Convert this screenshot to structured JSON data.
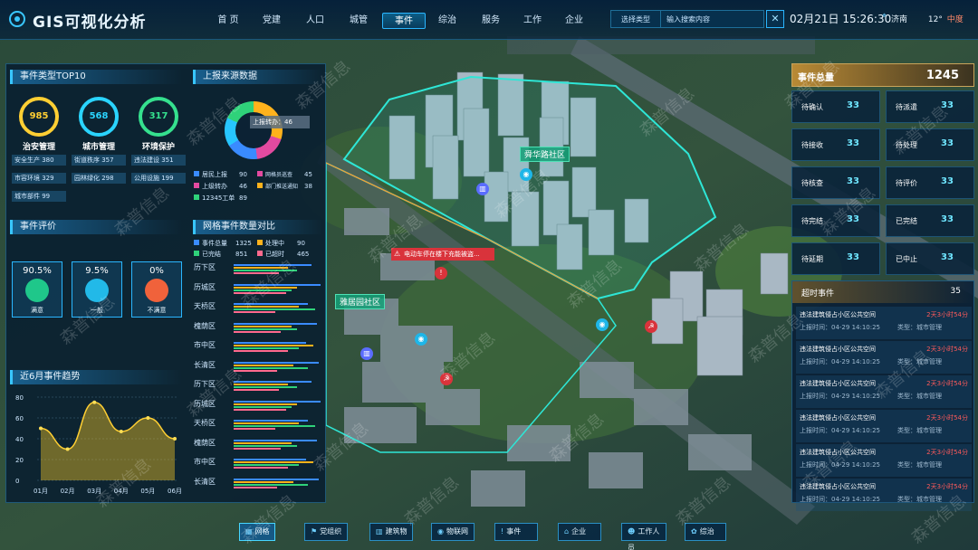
{
  "app": {
    "title": "GIS可视化分析"
  },
  "nav": {
    "items": [
      {
        "label": "首 页"
      },
      {
        "label": "党建"
      },
      {
        "label": "人口"
      },
      {
        "label": "城管"
      },
      {
        "label": "事件"
      },
      {
        "label": "综治"
      },
      {
        "label": "服务"
      },
      {
        "label": "工作"
      },
      {
        "label": "企业"
      }
    ],
    "active": "事件"
  },
  "search": {
    "type_label": "选择类型",
    "placeholder": "输入搜索内容",
    "close": "✕"
  },
  "header": {
    "datetime": "02月21日 15:26:30",
    "city": "济南",
    "temp": "12°",
    "condition": "中度"
  },
  "left": {
    "top10_title": "事件类型TOP10",
    "rings": [
      {
        "value": "985",
        "label": "治安管理",
        "color": "#ffcf33"
      },
      {
        "value": "568",
        "label": "城市管理",
        "color": "#2ad4ff"
      },
      {
        "value": "317",
        "label": "环境保护",
        "color": "#35e08e"
      }
    ],
    "tags": [
      "安全生产 380",
      "街道秩序 357",
      "违法建设 351",
      "市容环境 329",
      "园林绿化 298",
      "公用设施 199",
      "城市部件 99"
    ],
    "source_title": "上报来源数据",
    "tooltip": "上报转办：46",
    "source_legend": [
      {
        "name": "居民上报",
        "value": "90",
        "color": "#3a8bff"
      },
      {
        "name": "网格员巡查",
        "value": "45",
        "color": "#e24aa0"
      },
      {
        "name": "上级转办",
        "value": "46",
        "color": "#e24aa0"
      },
      {
        "name": "部门推送通知",
        "value": "38",
        "color": "#ffb21c"
      },
      {
        "name": "12345工单",
        "value": "89",
        "color": "#2fd27a"
      }
    ],
    "eval_title": "事件评价",
    "evals": [
      {
        "pct": "90.5%",
        "label": "满意",
        "color": "#1fc78a"
      },
      {
        "pct": "9.5%",
        "label": "一般",
        "color": "#22b9e8"
      },
      {
        "pct": "0%",
        "label": "不满意",
        "color": "#f0623b"
      }
    ],
    "grid_title": "网格事件数量对比",
    "grid_legend": [
      {
        "name": "事件总量",
        "value": "1325",
        "color": "#3a8bff"
      },
      {
        "name": "处理中",
        "value": "90",
        "color": "#ffb21c"
      },
      {
        "name": "已完结",
        "value": "851",
        "color": "#2fd27a"
      },
      {
        "name": "已超时",
        "value": "465",
        "color": "#ff6a8e"
      }
    ],
    "districts": [
      "历下区",
      "历城区",
      "天桥区",
      "槐荫区",
      "市中区",
      "长清区",
      "历下区",
      "历城区",
      "天桥区",
      "槐荫区",
      "市中区",
      "长清区"
    ],
    "trend_title": "近6月事件趋势"
  },
  "chart_data": {
    "type": "area",
    "categories": [
      "01月",
      "02月",
      "03月",
      "04月",
      "05月",
      "06月"
    ],
    "values": [
      50,
      30,
      75,
      47,
      60,
      40
    ],
    "ylim": [
      0,
      80
    ],
    "yticks": [
      "0",
      "20",
      "40",
      "60",
      "80"
    ],
    "title": "近6月事件趋势"
  },
  "right": {
    "total_label": "事件总量",
    "total_value": "1245",
    "cards": [
      {
        "label": "待确认",
        "value": "33"
      },
      {
        "label": "待派遣",
        "value": "33"
      },
      {
        "label": "待接收",
        "value": "33"
      },
      {
        "label": "待处理",
        "value": "33"
      },
      {
        "label": "待核查",
        "value": "33"
      },
      {
        "label": "待评价",
        "value": "33"
      },
      {
        "label": "待完结",
        "value": "33"
      },
      {
        "label": "已完结",
        "value": "33"
      },
      {
        "label": "待延期",
        "value": "33"
      },
      {
        "label": "已中止",
        "value": "33"
      }
    ],
    "overtime_title": "超时事件",
    "overtime_count": "35",
    "overtime_items": [
      {
        "title": "违法建筑侵占小区公共空间",
        "duration": "2天3小时54分",
        "time": "上报时间：04-29 14:10:25",
        "type": "类型：城市管理"
      },
      {
        "title": "违法建筑侵占小区公共空间",
        "duration": "2天3小时54分",
        "time": "上报时间：04-29 14:10:25",
        "type": "类型：城市管理"
      },
      {
        "title": "违法建筑侵占小区公共空间",
        "duration": "2天3小时54分",
        "time": "上报时间：04-29 14:10:25",
        "type": "类型：城市管理"
      },
      {
        "title": "违法建筑侵占小区公共空间",
        "duration": "2天3小时54分",
        "time": "上报时间：04-29 14:10:25",
        "type": "类型：城市管理"
      },
      {
        "title": "违法建筑侵占小区公共空间",
        "duration": "2天3小时54分",
        "time": "上报时间：04-29 14:10:25",
        "type": "类型：城市管理"
      },
      {
        "title": "违法建筑侵占小区公共空间",
        "duration": "2天3小时54分",
        "time": "上报时间：04-29 14:10:25",
        "type": "类型：城市管理"
      }
    ]
  },
  "map": {
    "community1": "舜华路社区",
    "community2": "雅居园社区",
    "alert": "电动车停在楼下充能被盗..."
  },
  "bottom_nav": [
    {
      "label": "网格",
      "icon": "▦"
    },
    {
      "label": "党组织",
      "icon": "⚑"
    },
    {
      "label": "建筑物",
      "icon": "▥"
    },
    {
      "label": "物联网",
      "icon": "◉"
    },
    {
      "label": "事件",
      "icon": "!"
    },
    {
      "label": "企业",
      "icon": "⌂"
    },
    {
      "label": "工作人员",
      "icon": "☻"
    },
    {
      "label": "综治",
      "icon": "✿"
    }
  ],
  "watermark": "森普信息"
}
